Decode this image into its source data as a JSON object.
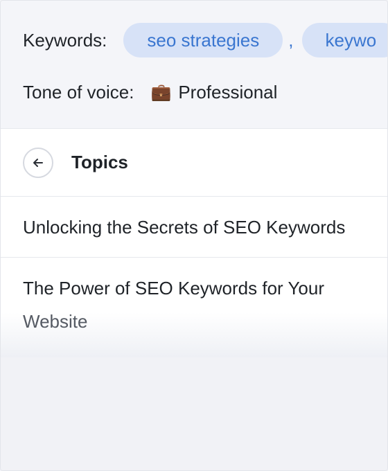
{
  "meta": {
    "keywords_label": "Keywords:",
    "keywords": [
      "seo strategies",
      "keywo"
    ],
    "separator": ",",
    "tone_label": "Tone of voice:",
    "tone_icon": "briefcase-icon",
    "tone_value": "Professional"
  },
  "topics": {
    "title": "Topics",
    "back_icon": "arrow-left-icon",
    "items": [
      {
        "line1": "Unlocking the Secrets of SEO Keywords",
        "line2": ""
      },
      {
        "line1": "The Power of SEO Keywords for Your",
        "line2": "Website"
      }
    ]
  },
  "colors": {
    "chip_bg": "#d7e2f7",
    "chip_text": "#3a76d0",
    "panel_bg": "#f4f5f9"
  }
}
